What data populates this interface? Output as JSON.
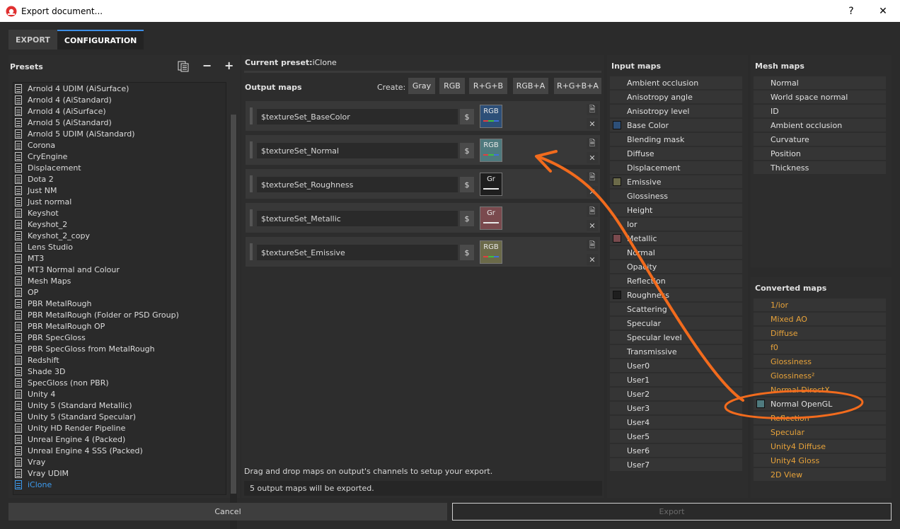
{
  "window": {
    "title": "Export document...",
    "help": "?",
    "close": "✕"
  },
  "tabs": [
    {
      "label": "EXPORT"
    },
    {
      "label": "CONFIGURATION"
    }
  ],
  "presets": {
    "title": "Presets",
    "items": [
      "Arnold 4  UDIM (AiSurface)",
      "Arnold 4 (AiStandard)",
      "Arnold 4 (AiSurface)",
      "Arnold 5 (AiStandard)",
      "Arnold 5 UDIM (AiStandard)",
      "Corona",
      "CryEngine",
      "Displacement",
      "Dota 2",
      "Just NM",
      "Just normal",
      "Keyshot",
      "Keyshot_2",
      "Keyshot_2_copy",
      "Lens Studio",
      "MT3",
      "MT3 Normal and Colour",
      "Mesh Maps",
      "OP",
      "PBR MetalRough",
      "PBR MetalRough (Folder or PSD Group)",
      "PBR MetalRough OP",
      "PBR SpecGloss",
      "PBR SpecGloss from MetalRough",
      "Redshift",
      "Shade 3D",
      "SpecGloss (non PBR)",
      "Unity 4",
      "Unity 5 (Standard Metallic)",
      "Unity 5 (Standard Specular)",
      "Unity HD Render Pipeline",
      "Unreal Engine 4 (Packed)",
      "Unreal Engine 4 SSS (Packed)",
      "Vray",
      "Vray UDIM",
      "iClone"
    ],
    "selected": "iClone"
  },
  "output": {
    "preset_label": "Current preset:",
    "preset_value": "iClone",
    "title": "Output maps",
    "create_label": "Create:",
    "create_buttons": [
      "Gray",
      "RGB",
      "R+G+B",
      "RGB+A",
      "R+G+B+A"
    ],
    "maps": [
      {
        "name": "$textureSet_BaseColor",
        "dollar": "$",
        "channel": "RGB",
        "color": "#2d4f78",
        "mode": "rgb"
      },
      {
        "name": "$textureSet_Normal",
        "dollar": "$",
        "channel": "RGB",
        "color": "#4f7a7e",
        "mode": "rgb"
      },
      {
        "name": "$textureSet_Roughness",
        "dollar": "$",
        "channel": "Gr",
        "color": "#1e1e1e",
        "mode": "gray"
      },
      {
        "name": "$textureSet_Metallic",
        "dollar": "$",
        "channel": "Gr",
        "color": "#7a4a4e",
        "mode": "gray"
      },
      {
        "name": "$textureSet_Emissive",
        "dollar": "$",
        "channel": "RGB",
        "color": "#6b6a49",
        "mode": "rgb"
      }
    ],
    "hint": "Drag and drop maps on output's channels to setup your export.",
    "status": "5 output maps will be exported."
  },
  "input_maps": {
    "title": "Input maps",
    "items": [
      {
        "label": "Ambient occlusion"
      },
      {
        "label": "Anisotropy angle"
      },
      {
        "label": "Anisotropy level"
      },
      {
        "label": "Base Color",
        "swatch": "#2d4f78"
      },
      {
        "label": "Blending mask"
      },
      {
        "label": "Diffuse"
      },
      {
        "label": "Displacement"
      },
      {
        "label": "Emissive",
        "swatch": "#6b6a49"
      },
      {
        "label": "Glossiness"
      },
      {
        "label": "Height"
      },
      {
        "label": "Ior"
      },
      {
        "label": "Metallic",
        "swatch": "#7a4a4e"
      },
      {
        "label": "Normal"
      },
      {
        "label": "Opacity"
      },
      {
        "label": "Reflection"
      },
      {
        "label": "Roughness",
        "swatch": "#1e1e1e"
      },
      {
        "label": "Scattering"
      },
      {
        "label": "Specular"
      },
      {
        "label": "Specular level"
      },
      {
        "label": "Transmissive"
      },
      {
        "label": "User0"
      },
      {
        "label": "User1"
      },
      {
        "label": "User2"
      },
      {
        "label": "User3"
      },
      {
        "label": "User4"
      },
      {
        "label": "User5"
      },
      {
        "label": "User6"
      },
      {
        "label": "User7"
      }
    ]
  },
  "mesh_maps": {
    "title": "Mesh maps",
    "items": [
      "Normal",
      "World space normal",
      "ID",
      "Ambient occlusion",
      "Curvature",
      "Position",
      "Thickness"
    ]
  },
  "converted_maps": {
    "title": "Converted maps",
    "items": [
      {
        "label": "1/ior"
      },
      {
        "label": "Mixed AO"
      },
      {
        "label": "Diffuse"
      },
      {
        "label": "f0"
      },
      {
        "label": "Glossiness"
      },
      {
        "label": "Glossiness²"
      },
      {
        "label": "Normal DirectX"
      },
      {
        "label": "Normal OpenGL",
        "swatch": "#4f7a7e",
        "highlight": true
      },
      {
        "label": "Reflection"
      },
      {
        "label": "Specular"
      },
      {
        "label": "Unity4 Diffuse"
      },
      {
        "label": "Unity4 Gloss"
      },
      {
        "label": "2D View"
      }
    ]
  },
  "buttons": {
    "cancel": "Cancel",
    "export": "Export"
  },
  "colors": {
    "accent": "#3d8ee6",
    "converted_text": "#e8a33a",
    "annotation": "#f26b1d"
  }
}
